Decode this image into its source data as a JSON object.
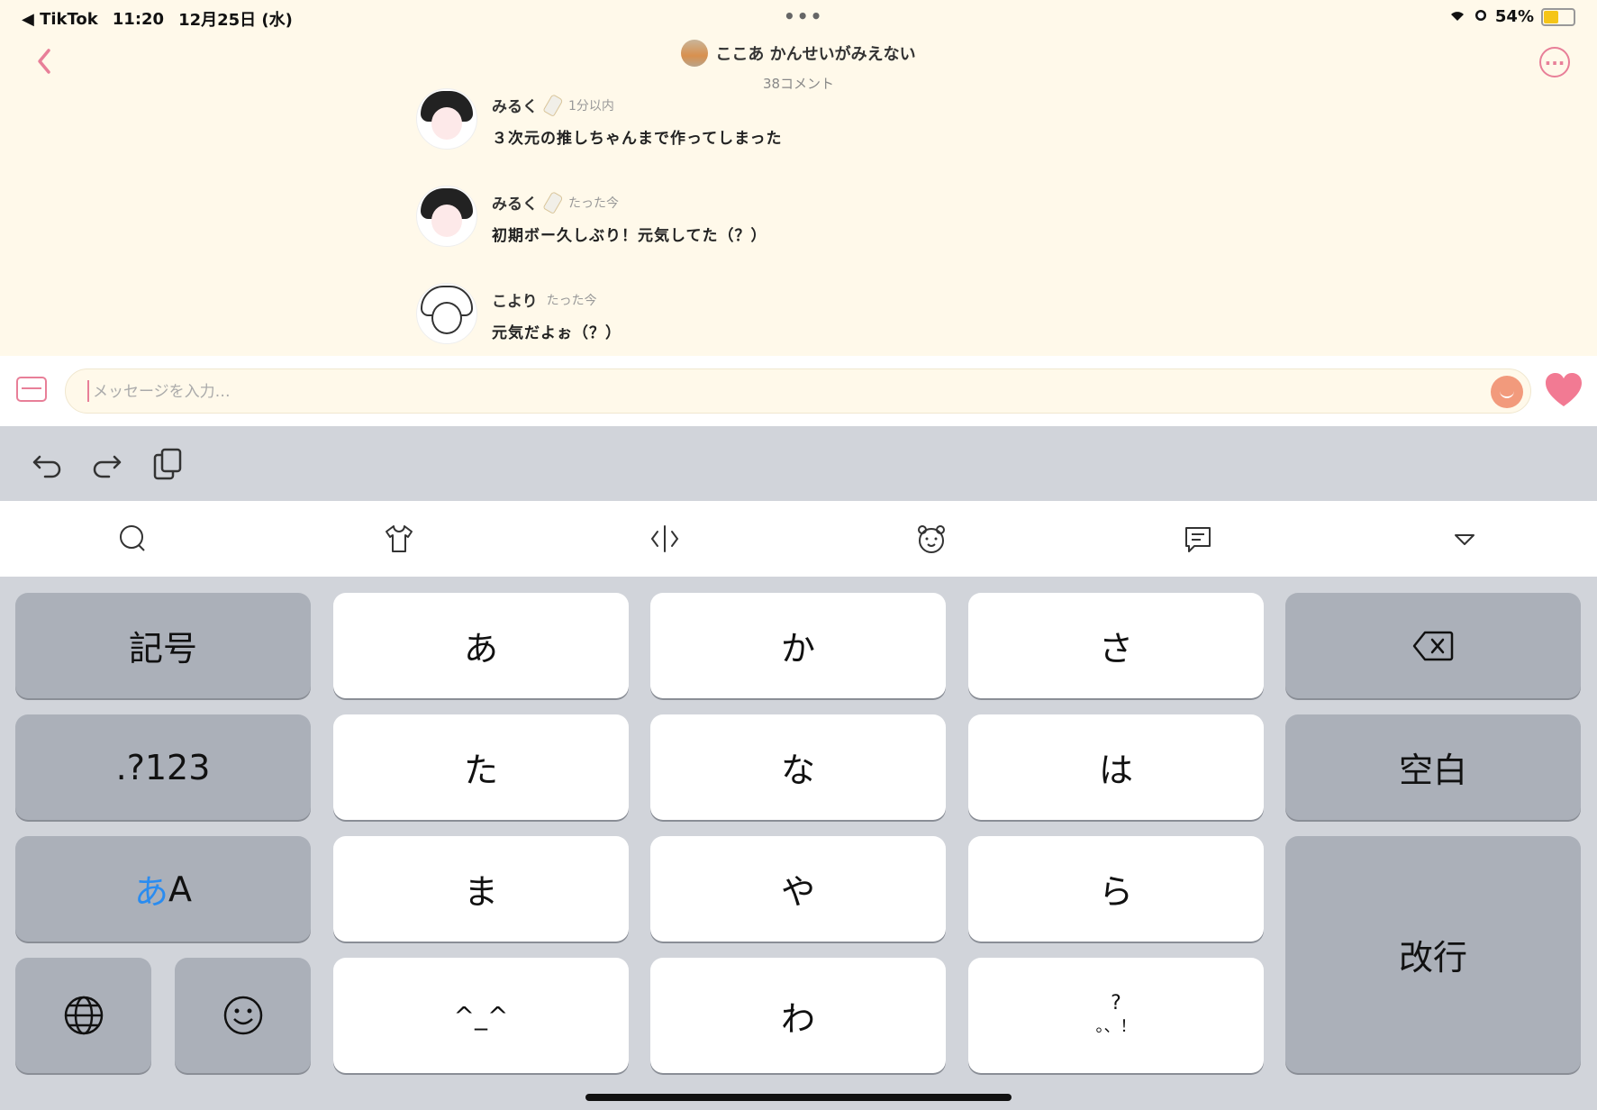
{
  "status": {
    "back_app": "◀ TikTok",
    "time": "11:20",
    "date": "12月25日 (水)",
    "battery": "54%",
    "battery_level": 0.54
  },
  "header": {
    "title": "ここあ かんせいがみえない",
    "subtitle": "38コメント"
  },
  "messages": [
    {
      "name": "みるく",
      "time": "1分以内",
      "text": "３次元の推しちゃんまで作ってしまった"
    },
    {
      "name": "みるく",
      "time": "たった今",
      "text": "初期ボー久しぶり！元気してた（？）"
    },
    {
      "name": "こより",
      "time": "たった今",
      "text": "元気だよぉ（？）"
    }
  ],
  "input": {
    "placeholder": "メッセージを入力…"
  },
  "keys": {
    "symbols": "記号",
    "a": "あ",
    "ka": "か",
    "sa": "さ",
    "num": ".?123",
    "ta": "た",
    "na": "な",
    "ha": "は",
    "space": "空白",
    "mode_a": "あ",
    "mode_A": "A",
    "ma": "ま",
    "ya": "や",
    "ra": "ら",
    "enter": "改行",
    "kaomoji": "^_^",
    "wa": "わ",
    "punct_top": "?",
    "punct_bottom": "。、！"
  },
  "colors": {
    "accent": "#e87f98",
    "background": "#fff9ea",
    "keyboard": "#d1d4da"
  }
}
